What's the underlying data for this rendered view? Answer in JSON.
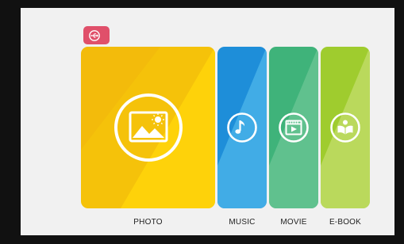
{
  "colors": {
    "frame": "#111111",
    "background": "#f1f1f1",
    "source_badge": "#e0506a",
    "photo": "#f5c20a",
    "music": "#1e8ed9",
    "movie": "#3fb37a",
    "ebook": "#9fcc2e",
    "icon_stroke": "#ffffff",
    "label_text": "#222222"
  },
  "source": {
    "icon": "usb-icon"
  },
  "tiles": [
    {
      "id": "photo",
      "label": "PHOTO",
      "icon": "image-icon",
      "color": "#f5c20a"
    },
    {
      "id": "music",
      "label": "MUSIC",
      "icon": "music-note-icon",
      "color": "#1e8ed9"
    },
    {
      "id": "movie",
      "label": "MOVIE",
      "icon": "film-icon",
      "color": "#3fb37a"
    },
    {
      "id": "ebook",
      "label": "E-BOOK",
      "icon": "book-icon",
      "color": "#9fcc2e"
    }
  ]
}
